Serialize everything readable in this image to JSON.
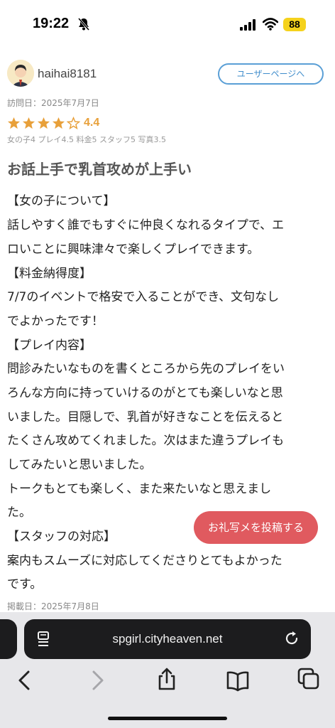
{
  "status": {
    "time": "19:22",
    "battery": "88"
  },
  "review": {
    "username": "haihai8181",
    "user_page_label": "ユーザーページへ",
    "visit_date": "訪問日：2025年7月7日",
    "rating": "4.4",
    "rating_value": 4.4,
    "sub_ratings": "女の子4 プレイ4.5 料金5 スタッフ5 写真3.5",
    "title": "お話上手で乳首攻めが上手い",
    "lines": [
      "【女の子について】",
      "話しやすく誰でもすぐに仲良くなれるタイプで、エ",
      "ロいことに興味津々で楽しくプレイできます。",
      "【料金納得度】",
      "7/7のイベントで格安で入ることができ、文句なし",
      "でよかったです！",
      "【プレイ内容】",
      "問診みたいなものを書くところから先のプレイをい",
      "ろんな方向に持っていけるのがとても楽しいなと思",
      "いました。目隠しで、乳首が好きなことを伝えると",
      "たくさん攻めてくれました。次はまた違うプレイも",
      "してみたいと思いました。",
      "トークもとても楽しく、また来たいなと思えまし",
      "た。",
      "【スタッフの対応】",
      "案内もスムーズに対応してくださりとてもよかった",
      "です。"
    ],
    "post_date": "掲載日：2025年7月8日",
    "thanks_photo_button": "お礼写メを投稿する"
  },
  "browser": {
    "url": "spgirl.cityheaven.net"
  },
  "colors": {
    "accent_blue": "#3f8ccb",
    "star": "#e8a03a",
    "cta": "#e05a5f"
  }
}
